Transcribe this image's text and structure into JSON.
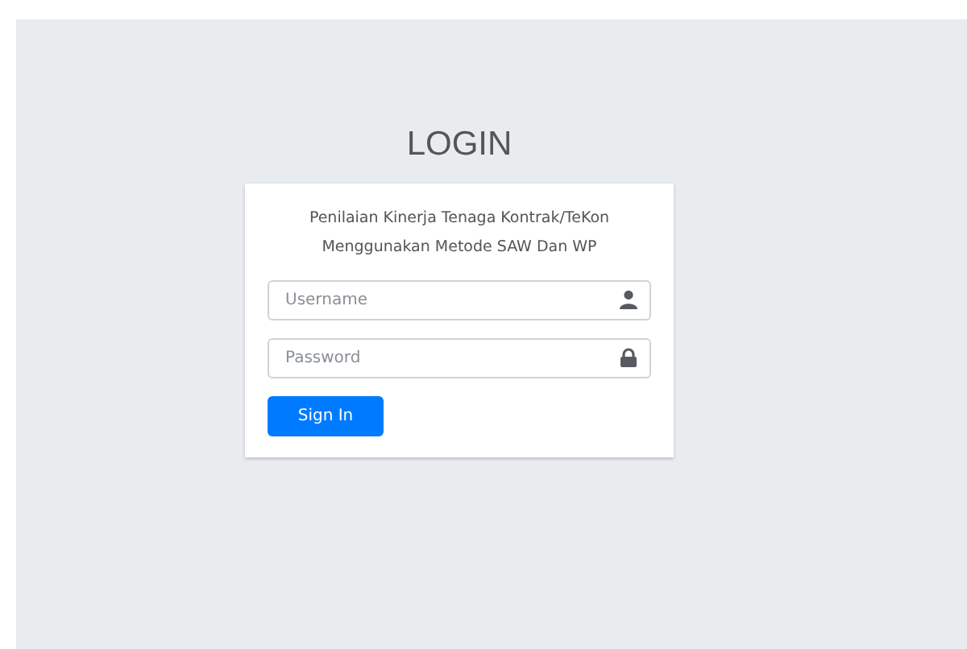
{
  "heading": "LOGIN",
  "card": {
    "subtitle_lines": [
      "Penilaian Kinerja Tenaga Kontrak/TeKon",
      "Menggunakan Metode SAW Dan WP"
    ],
    "fields": [
      {
        "kind": "user",
        "placeholder": "Username"
      },
      {
        "kind": "password",
        "placeholder": "Password"
      }
    ],
    "button": "Sign In"
  }
}
